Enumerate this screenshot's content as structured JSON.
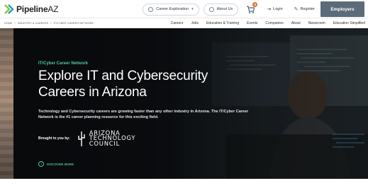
{
  "brand": {
    "name": "Pipeline",
    "suffix": "AZ"
  },
  "top_actions": {
    "career_exploration": "Career Exploration",
    "about_us": "About Us",
    "cart_count": "0",
    "login": "Login",
    "register": "Register",
    "employers": "Employers"
  },
  "breadcrumb": [
    "HOME",
    "/",
    "INDUSTRY & CAREERS",
    "/",
    "IT/CYBER CAREER NETWORK"
  ],
  "nav": [
    "Careers",
    "Jobs",
    "Education & Training",
    "Events",
    "Companies",
    "About",
    "Newsroom",
    "Education Simplified"
  ],
  "hero": {
    "eyebrow": "IT/Cyber Career Network",
    "headline": "Explore IT and Cybersecurity Careers in Arizona",
    "description": "Technology and Cybersecurity careers are growing faster than any other industry in Arizona. The IT/Cyber Career Network is the #1 career planning resource for this exciting field.",
    "brought_by": "Brought to you by:",
    "sponsor_lines": [
      "ARIZONA",
      "TECHNOLOGY",
      "COUNCIL"
    ],
    "discover": "DISCOVER MORE"
  },
  "colors": {
    "accent": "#4fc7a0",
    "employers_bg": "#5c6b7a",
    "badge": "#e8712c"
  },
  "icons": [
    "compass-icon",
    "info-icon",
    "cart-icon",
    "login-icon",
    "register-icon",
    "arrow-down-icon"
  ]
}
